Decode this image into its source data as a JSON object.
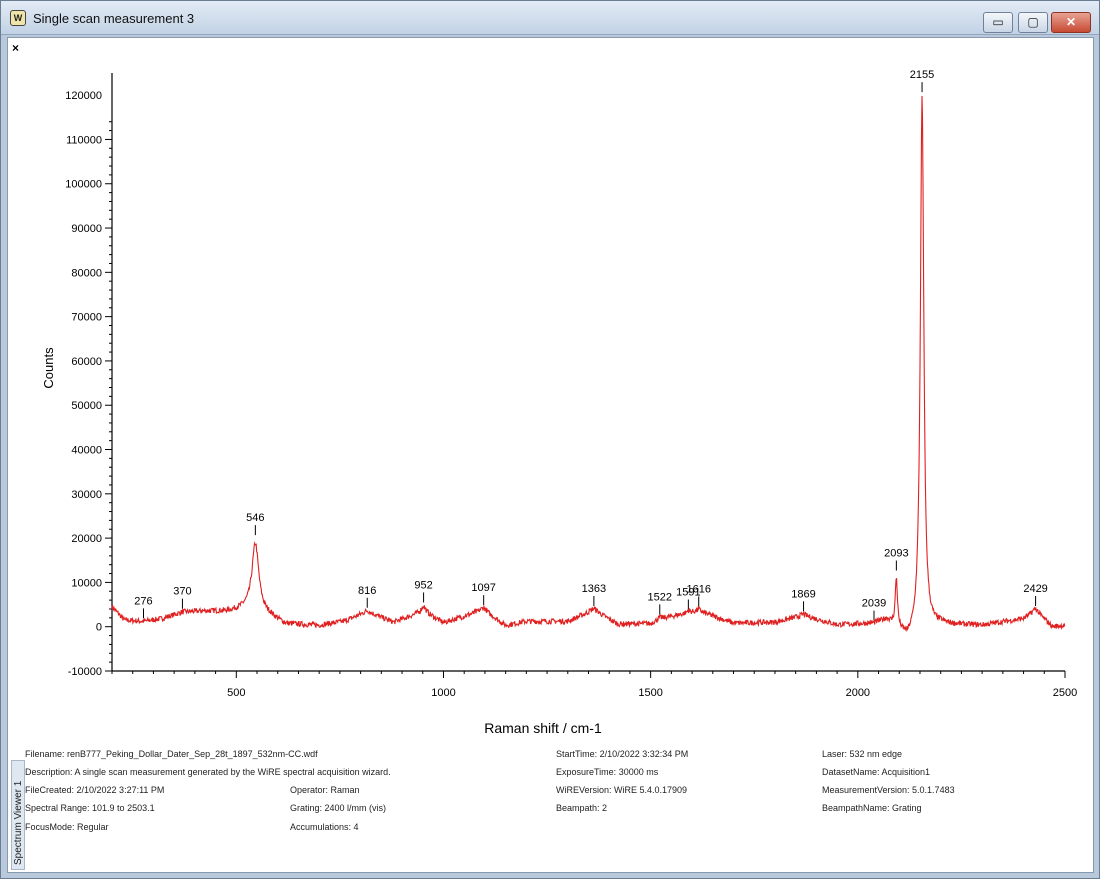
{
  "window": {
    "title": "Single scan measurement 3",
    "app_icon": "wire-app-icon",
    "buttons": {
      "minimize": "▭",
      "maximize": "▢",
      "close": "✕"
    }
  },
  "doc_close": "×",
  "side_tab": "Spectrum Viewer 1",
  "chart_data": {
    "type": "line",
    "xlabel": "Raman shift / cm-1",
    "ylabel": "Counts",
    "xlim": [
      200,
      2500
    ],
    "ylim": [
      -10000,
      125000
    ],
    "xticks": [
      500,
      1000,
      1500,
      2000,
      2500
    ],
    "yticks": [
      -10000,
      0,
      10000,
      20000,
      30000,
      40000,
      50000,
      60000,
      70000,
      80000,
      90000,
      100000,
      110000,
      120000
    ],
    "line_color": "#e02020",
    "baseline": [
      [
        200,
        4500
      ],
      [
        230,
        1500
      ],
      [
        276,
        1200
      ],
      [
        320,
        1800
      ],
      [
        370,
        3300
      ],
      [
        420,
        3500
      ],
      [
        480,
        3500
      ],
      [
        520,
        4000
      ],
      [
        580,
        2500
      ],
      [
        620,
        600
      ],
      [
        700,
        300
      ],
      [
        760,
        1200
      ],
      [
        816,
        3300
      ],
      [
        880,
        1000
      ],
      [
        952,
        3500
      ],
      [
        1000,
        900
      ],
      [
        1097,
        3700
      ],
      [
        1150,
        300
      ],
      [
        1200,
        1200
      ],
      [
        1300,
        1200
      ],
      [
        1363,
        3700
      ],
      [
        1420,
        600
      ],
      [
        1500,
        700
      ],
      [
        1522,
        1800
      ],
      [
        1559,
        2500
      ],
      [
        1616,
        3500
      ],
      [
        1700,
        800
      ],
      [
        1800,
        1000
      ],
      [
        1869,
        2500
      ],
      [
        1950,
        400
      ],
      [
        2039,
        700
      ],
      [
        2070,
        1500
      ],
      [
        2120,
        -3000
      ],
      [
        2200,
        400
      ],
      [
        2300,
        300
      ],
      [
        2400,
        1800
      ],
      [
        2429,
        3500
      ],
      [
        2470,
        0
      ],
      [
        2500,
        300
      ]
    ],
    "peaks": [
      {
        "x": 276,
        "height": 0,
        "width": 10
      },
      {
        "x": 370,
        "height": 0,
        "width": 15
      },
      {
        "x": 546,
        "height": 15500,
        "width": 10
      },
      {
        "x": 816,
        "height": 300,
        "width": 15
      },
      {
        "x": 952,
        "height": 1200,
        "width": 6
      },
      {
        "x": 1097,
        "height": 600,
        "width": 10
      },
      {
        "x": 1363,
        "height": 400,
        "width": 12
      },
      {
        "x": 1522,
        "height": 300,
        "width": 5
      },
      {
        "x": 1591,
        "height": 600,
        "width": 5
      },
      {
        "x": 1616,
        "height": 400,
        "width": 6
      },
      {
        "x": 1869,
        "height": 300,
        "width": 8
      },
      {
        "x": 2039,
        "height": 0,
        "width": 5
      },
      {
        "x": 2093,
        "height": 11000,
        "width": 3.2
      },
      {
        "x": 2155,
        "height": 121000,
        "width": 5
      },
      {
        "x": 2429,
        "height": 600,
        "width": 8
      }
    ],
    "peak_labels": [
      {
        "x": 276,
        "label": "276",
        "y": 1200
      },
      {
        "x": 370,
        "label": "370",
        "y": 3400
      },
      {
        "x": 546,
        "label": "546",
        "y": 20000
      },
      {
        "x": 816,
        "label": "816",
        "y": 3600
      },
      {
        "x": 952,
        "label": "952",
        "y": 4800
      },
      {
        "x": 1097,
        "label": "1097",
        "y": 4200
      },
      {
        "x": 1363,
        "label": "1363",
        "y": 4000
      },
      {
        "x": 1522,
        "label": "1522",
        "y": 2100
      },
      {
        "x": 1591,
        "label": "1591",
        "y": 3200
      },
      {
        "x": 1616,
        "label": "1616",
        "y": 3900
      },
      {
        "x": 1869,
        "label": "1869",
        "y": 2800
      },
      {
        "x": 2039,
        "label": "2039",
        "y": 700
      },
      {
        "x": 2093,
        "label": "2093",
        "y": 12000
      },
      {
        "x": 2155,
        "label": "2155",
        "y": 120000
      },
      {
        "x": 2429,
        "label": "2429",
        "y": 4000
      }
    ]
  },
  "info": {
    "filename": "Filename: renB777_Peking_Dollar_Dater_Sep_28t_1897_532nm-CC.wdf",
    "description": "Description: A single scan measurement generated by the WiRE spectral acquisition wizard.",
    "file_created": "FileCreated: 2/10/2022 3:27:11 PM",
    "spectral_range": "Spectral Range: 101.9 to 2503.1",
    "focus_mode": "FocusMode: Regular",
    "operator": "Operator: Raman",
    "grating": "Grating: 2400 l/mm (vis)",
    "accumulations": "Accumulations: 4",
    "start_time": "StartTime: 2/10/2022 3:32:34 PM",
    "exposure_time": "ExposureTime: 30000 ms",
    "wire_version": "WiREVersion: WiRE 5.4.0.17909",
    "beampath": "Beampath: 2",
    "laser": "Laser: 532 nm edge",
    "dataset_name": "DatasetName: Acquisition1",
    "measurement_version": "MeasurementVersion: 5.0.1.7483",
    "beampath_name": "BeampathName: Grating"
  }
}
